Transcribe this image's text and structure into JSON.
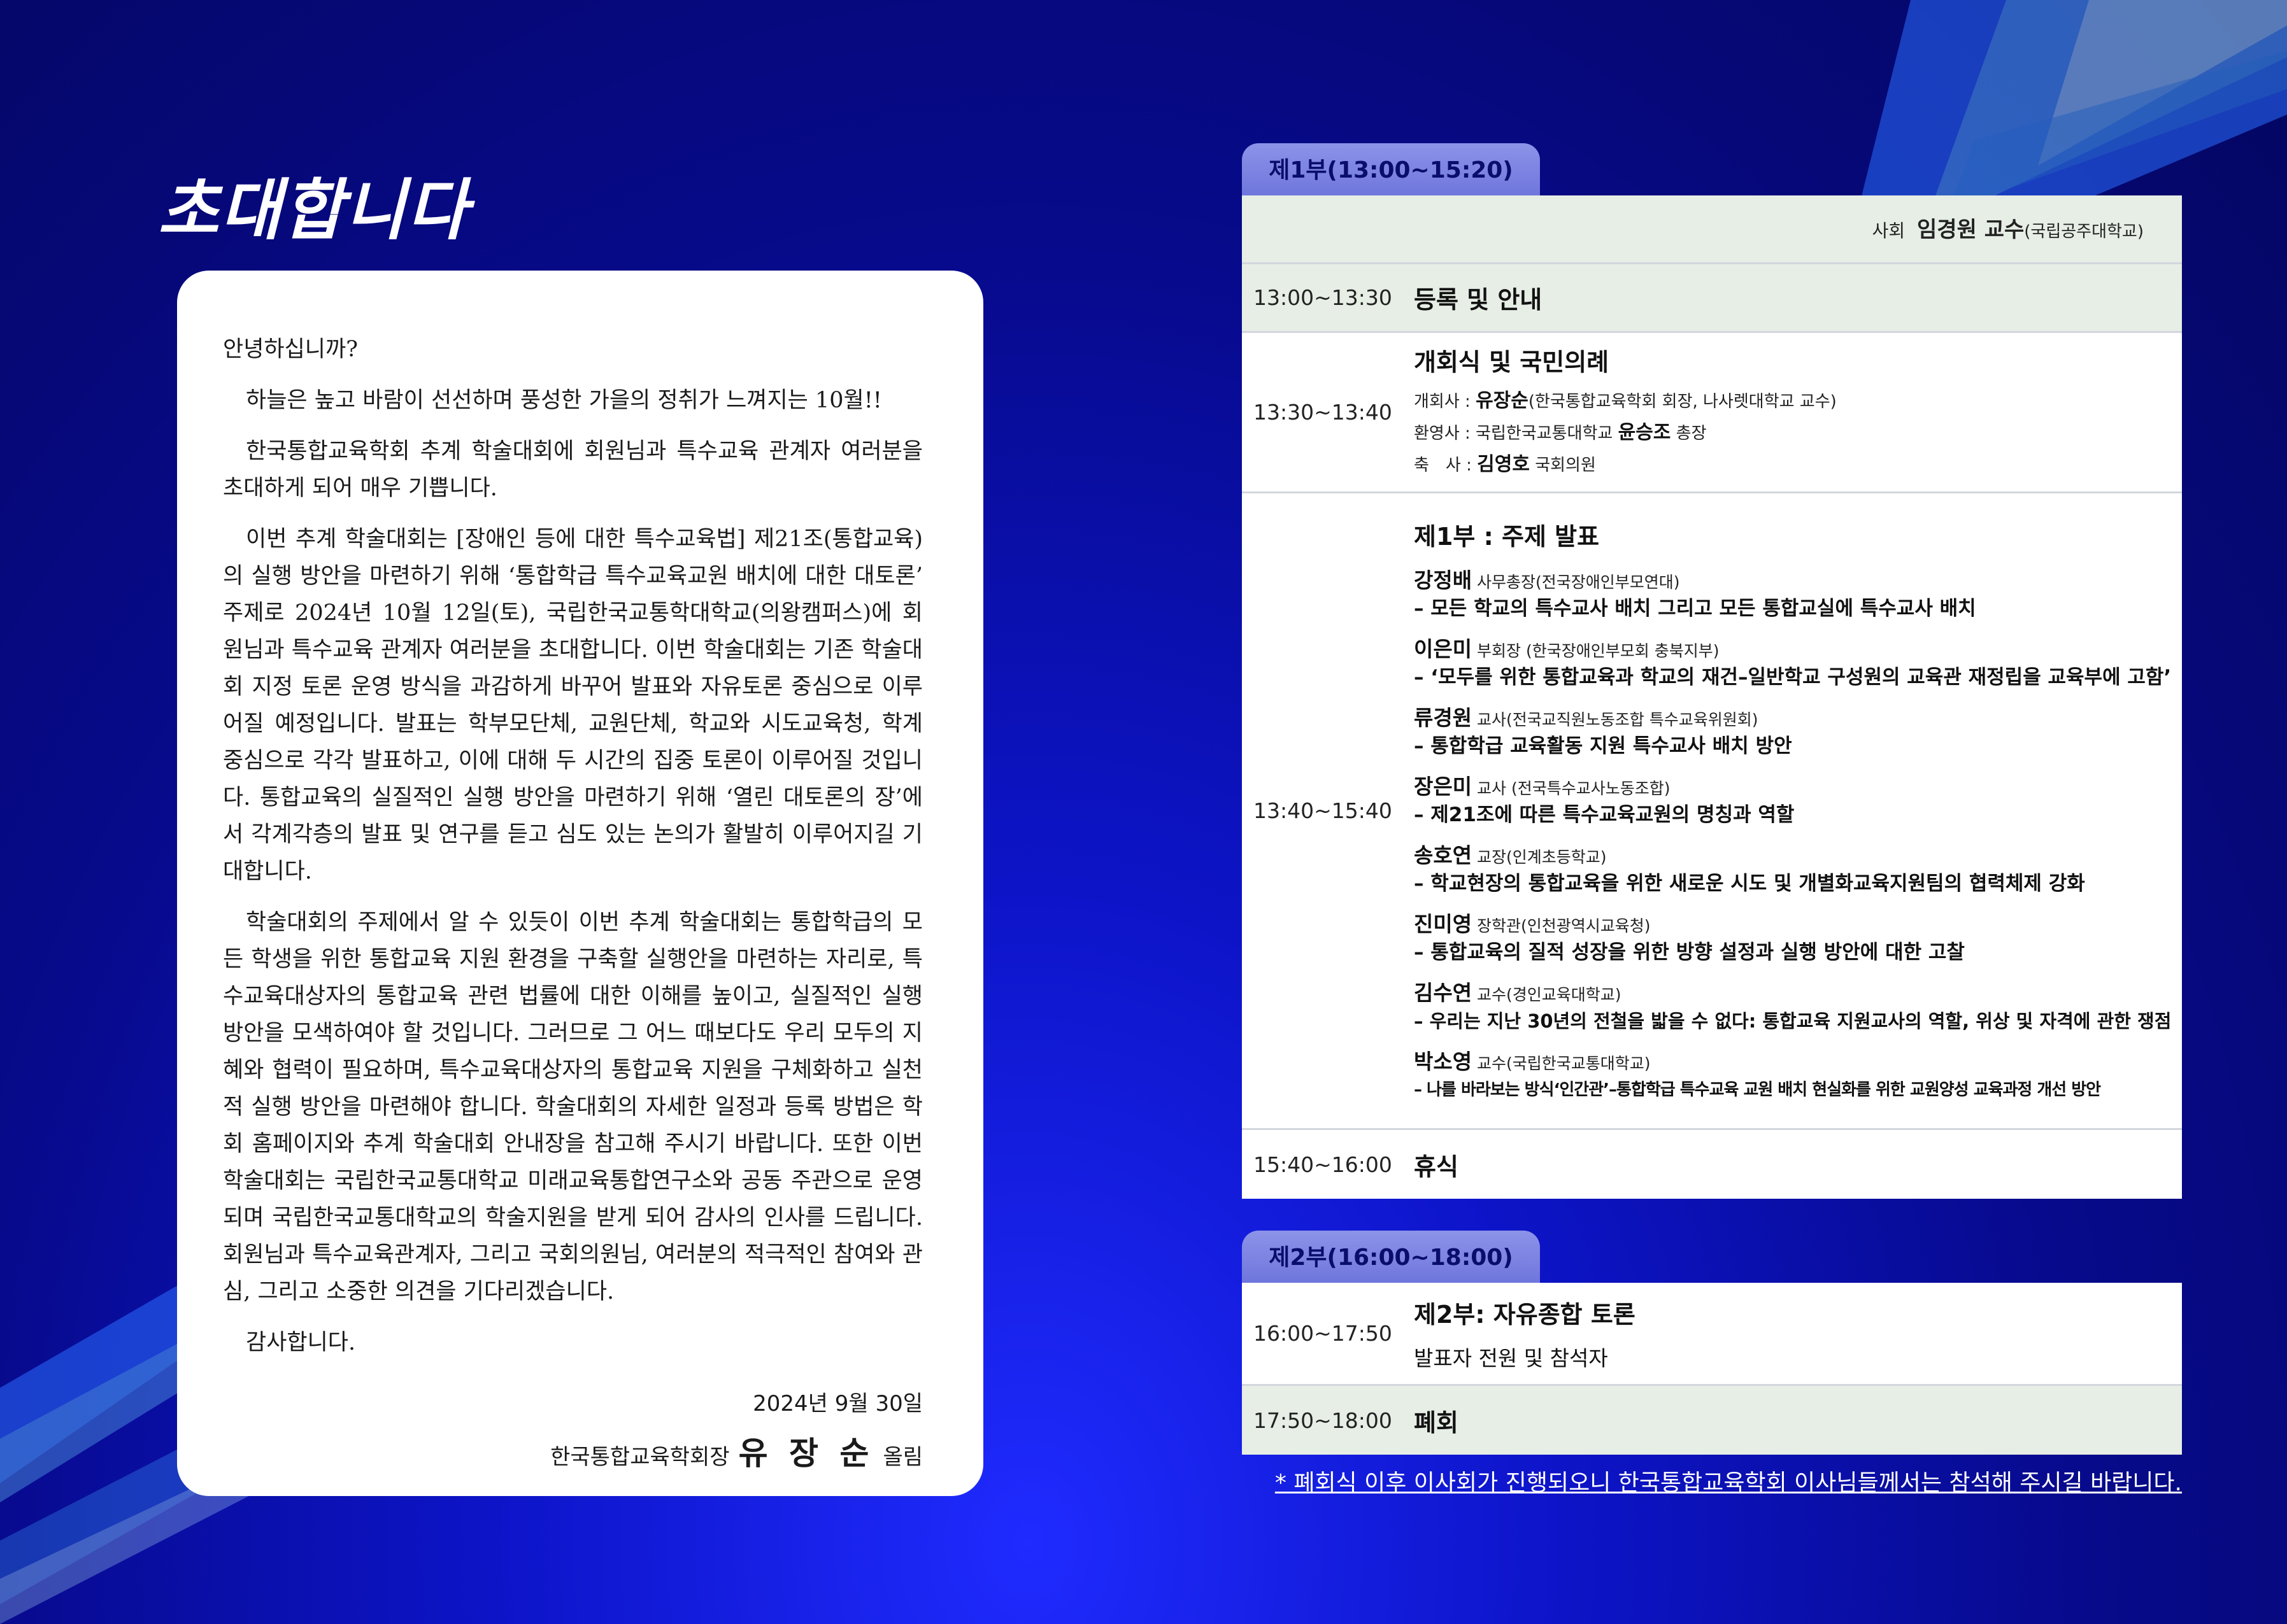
{
  "title": "초대합니다",
  "letter": {
    "greeting": "안녕하십니까?",
    "paragraphs": [
      "하늘은 높고 바람이 선선하며 풍성한 가을의 정취가 느껴지는 10월!!",
      "한국통합교육학회 추계 학술대회에 회원님과 특수교육 관계자 여러분을 초대하게 되어 매우 기쁩니다.",
      "이번 추계 학술대회는 [장애인 등에 대한 특수교육법] 제21조(통합교육)의 실행 방안을 마련하기 위해 ‘통합학급 특수교육교원 배치에 대한 대토론’ 주제로 2024년 10월 12일(토), 국립한국교통학대학교(의왕캠퍼스)에 회원님과 특수교육 관계자 여러분을 초대합니다. 이번 학술대회는 기존 학술대회 지정 토론 운영 방식을 과감하게 바꾸어 발표와 자유토론 중심으로 이루어질 예정입니다. 발표는 학부모단체, 교원단체, 학교와 시도교육청, 학계 중심으로 각각 발표하고, 이에 대해 두 시간의 집중 토론이 이루어질 것입니다. 통합교육의 실질적인 실행 방안을 마련하기 위해 ‘열린 대토론의 장’에서 각계각층의 발표 및 연구를 듣고 심도 있는 논의가 활발히 이루어지길 기대합니다.",
      "학술대회의 주제에서 알 수 있듯이 이번 추계 학술대회는 통합학급의 모든 학생을 위한 통합교육 지원 환경을 구축할 실행안을 마련하는 자리로, 특수교육대상자의 통합교육 관련 법률에 대한 이해를 높이고, 실질적인 실행 방안을 모색하여야 할 것입니다. 그러므로 그 어느 때보다도 우리 모두의 지혜와 협력이 필요하며, 특수교육대상자의 통합교육 지원을 구체화하고 실천적 실행 방안을 마련해야 합니다. 학술대회의 자세한 일정과 등록 방법은 학회 홈페이지와 추계 학술대회 안내장을 참고해 주시기 바랍니다. 또한 이번 학술대회는 국립한국교통대학교 미래교육통합연구소와 공동 주관으로 운영되며 국립한국교통대학교의 학술지원을 받게 되어 감사의 인사를 드립니다. 회원님과 특수교육관계자, 그리고 국회의원님, 여러분의 적극적인 참여와 관심, 그리고 소중한 의견을 기다리겠습니다."
    ],
    "thanks": "감사합니다.",
    "date": "2024년 9월 30일",
    "sign_prefix": "한국통합교육학회장",
    "sign_name": "유 장 순",
    "sign_suffix": "올림"
  },
  "part1": {
    "tab": "제1부(13:00~15:20)",
    "host_label": "사회",
    "host_name": "임경원 교수",
    "host_affil": "(국립공주대학교)",
    "rows": [
      {
        "time": "13:00~13:30",
        "title": "등록 및 안내"
      },
      {
        "time": "13:30~13:40",
        "title": "개회식 및 국민의례",
        "l1_label": "개회사 : ",
        "l1_name": "유장순",
        "l1_rest": "(한국통합교육학회 회장, 나사렛대학교 교수)",
        "l2_label": "환영사 : 국립한국교통대학교 ",
        "l2_name": "윤승조",
        "l2_rest": " 총장",
        "l3_label": "축　사 : ",
        "l3_name": "김영호",
        "l3_rest": " 국회의원"
      },
      {
        "time": "13:40~15:40",
        "title": "제1부 : 주제 발표"
      },
      {
        "time": "15:40~16:00",
        "title": "휴식"
      }
    ],
    "speakers": [
      {
        "name": "강정배",
        "role": " 사무총장(전국장애인부모연대)",
        "topic": "– 모든 학교의 특수교사 배치 그리고 모든 통합교실에 특수교사 배치"
      },
      {
        "name": "이은미",
        "role": " 부회장 (한국장애인부모회 충북지부)",
        "topic": "– ‘모두를 위한 통합교육과 학교의 재건–일반학교 구성원의 교육관 재정립을 교육부에 고함’"
      },
      {
        "name": "류경원",
        "role": " 교사(전국교직원노동조합 특수교육위원회)",
        "topic": "– 통합학급 교육활동 지원 특수교사 배치 방안"
      },
      {
        "name": "장은미",
        "role": " 교사 (전국특수교사노동조합)",
        "topic": "– 제21조에 따른 특수교육교원의 명칭과 역할"
      },
      {
        "name": "송호연",
        "role": " 교장(인계초등학교)",
        "topic": "– 학교현장의 통합교육을 위한 새로운 시도 및 개별화교육지원팀의 협력체제 강화"
      },
      {
        "name": "진미영",
        "role": " 장학관(인천광역시교육청)",
        "topic": "– 통합교육의 질적 성장을 위한 방향 설정과 실행 방안에 대한 고찰"
      },
      {
        "name": "김수연",
        "role": " 교수(경인교육대학교)",
        "topic": "– 우리는 지난 30년의 전철을 밟을 수 없다: 통합교육 지원교사의 역할, 위상 및 자격에 관한 쟁점"
      },
      {
        "name": "박소영",
        "role": " 교수(국립한국교통대학교)",
        "topic": "– 나를 바라보는 방식‘인간관’–통합학급 특수교육 교원 배치 현실화를 위한 교원양성 교육과정 개선 방안"
      }
    ]
  },
  "part2": {
    "tab": "제2부(16:00~18:00)",
    "rows": [
      {
        "time": "16:00~17:50",
        "title": "제2부: 자유종합 토론",
        "sub": "발표자 전원 및 참석자"
      },
      {
        "time": "17:50~18:00",
        "title": "폐회"
      }
    ]
  },
  "notice": "* 폐회식 이후 이사회가 진행되오니 한국통합교육학회 이사님들께서는 참석해 주시길 바랍니다."
}
